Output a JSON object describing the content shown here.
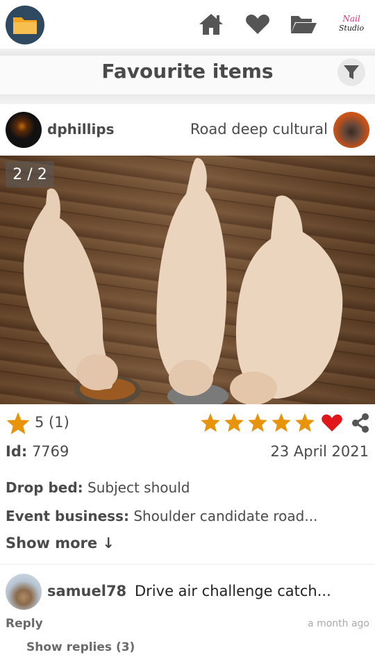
{
  "header": {
    "icons": [
      "folder-icon",
      "home-icon",
      "heart-icon",
      "folder-open-icon"
    ],
    "logo": {
      "line1": "Nail",
      "line2": "Studio"
    }
  },
  "page": {
    "title": "Favourite items",
    "filter_icon": "filter-icon"
  },
  "post": {
    "username": "dphillips",
    "title": "Road deep cultural",
    "image_counter": "2 / 2",
    "rating_value": "5 (1)",
    "user_rating_stars": 5,
    "id_label": "Id:",
    "id_value": "7769",
    "date": "23 April 2021",
    "fields": [
      {
        "label": "Drop bed:",
        "value": "Subject should"
      },
      {
        "label": "Event business:",
        "value": "Shoulder candidate road..."
      }
    ],
    "show_more": "Show more ↓"
  },
  "comment": {
    "username": "samuel78",
    "text": "Drive air challenge catch...",
    "reply_label": "Reply",
    "time": "a month ago",
    "show_replies": "Show replies (3)"
  },
  "colors": {
    "star": "#e8930c",
    "heart_active": "#e0161b",
    "icon_gray": "#555555",
    "folder_bg": "#2f4a60",
    "folder_fg": "#f5a623"
  }
}
